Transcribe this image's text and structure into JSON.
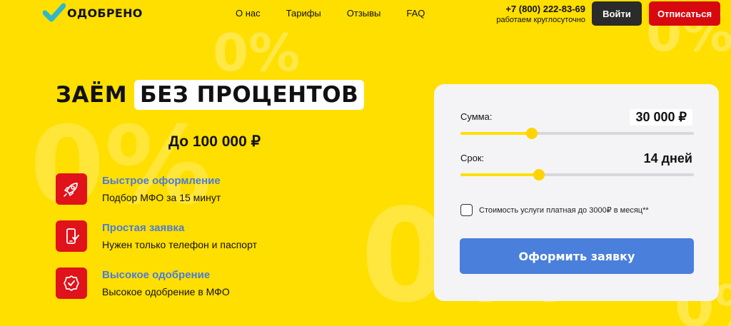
{
  "brand": {
    "name": "ОДОБРЕНО",
    "accent": "#FFDF00",
    "check_color": "#2DB8C9"
  },
  "bg_symbol": "0%",
  "nav": {
    "items": [
      {
        "label": "О нас"
      },
      {
        "label": "Тарифы"
      },
      {
        "label": "Отзывы"
      },
      {
        "label": "FAQ"
      }
    ]
  },
  "contact": {
    "phone": "+7 (800) 222-83-69",
    "hours": "работаем круглосуточно"
  },
  "header_buttons": {
    "login": "Войти",
    "unsubscribe": "Отписаться"
  },
  "hero": {
    "title_part1": "ЗАЁМ",
    "title_part2": "БЕЗ ПРОЦЕНТОВ",
    "subtitle": "До 100 000 ₽"
  },
  "features": [
    {
      "icon": "rocket-icon",
      "title": "Быстрое оформление",
      "desc": "Подбор МФО за 15 минут"
    },
    {
      "icon": "phone-check-icon",
      "title": "Простая заявка",
      "desc": "Нужен только телефон и паспорт"
    },
    {
      "icon": "approval-badge-icon",
      "title": "Высокое одобрение",
      "desc": "Высокое одобрение в МФО"
    }
  ],
  "form": {
    "amount_label": "Сумма:",
    "amount_value": "30 000 ₽",
    "amount_fraction": 0.305,
    "term_label": "Срок:",
    "term_value": "14 дней",
    "term_fraction": 0.335,
    "consent_text": "Стоимость услуги платная до 3000₽ в месяц**",
    "consent_checked": false,
    "submit_label": "Оформить заявку"
  }
}
